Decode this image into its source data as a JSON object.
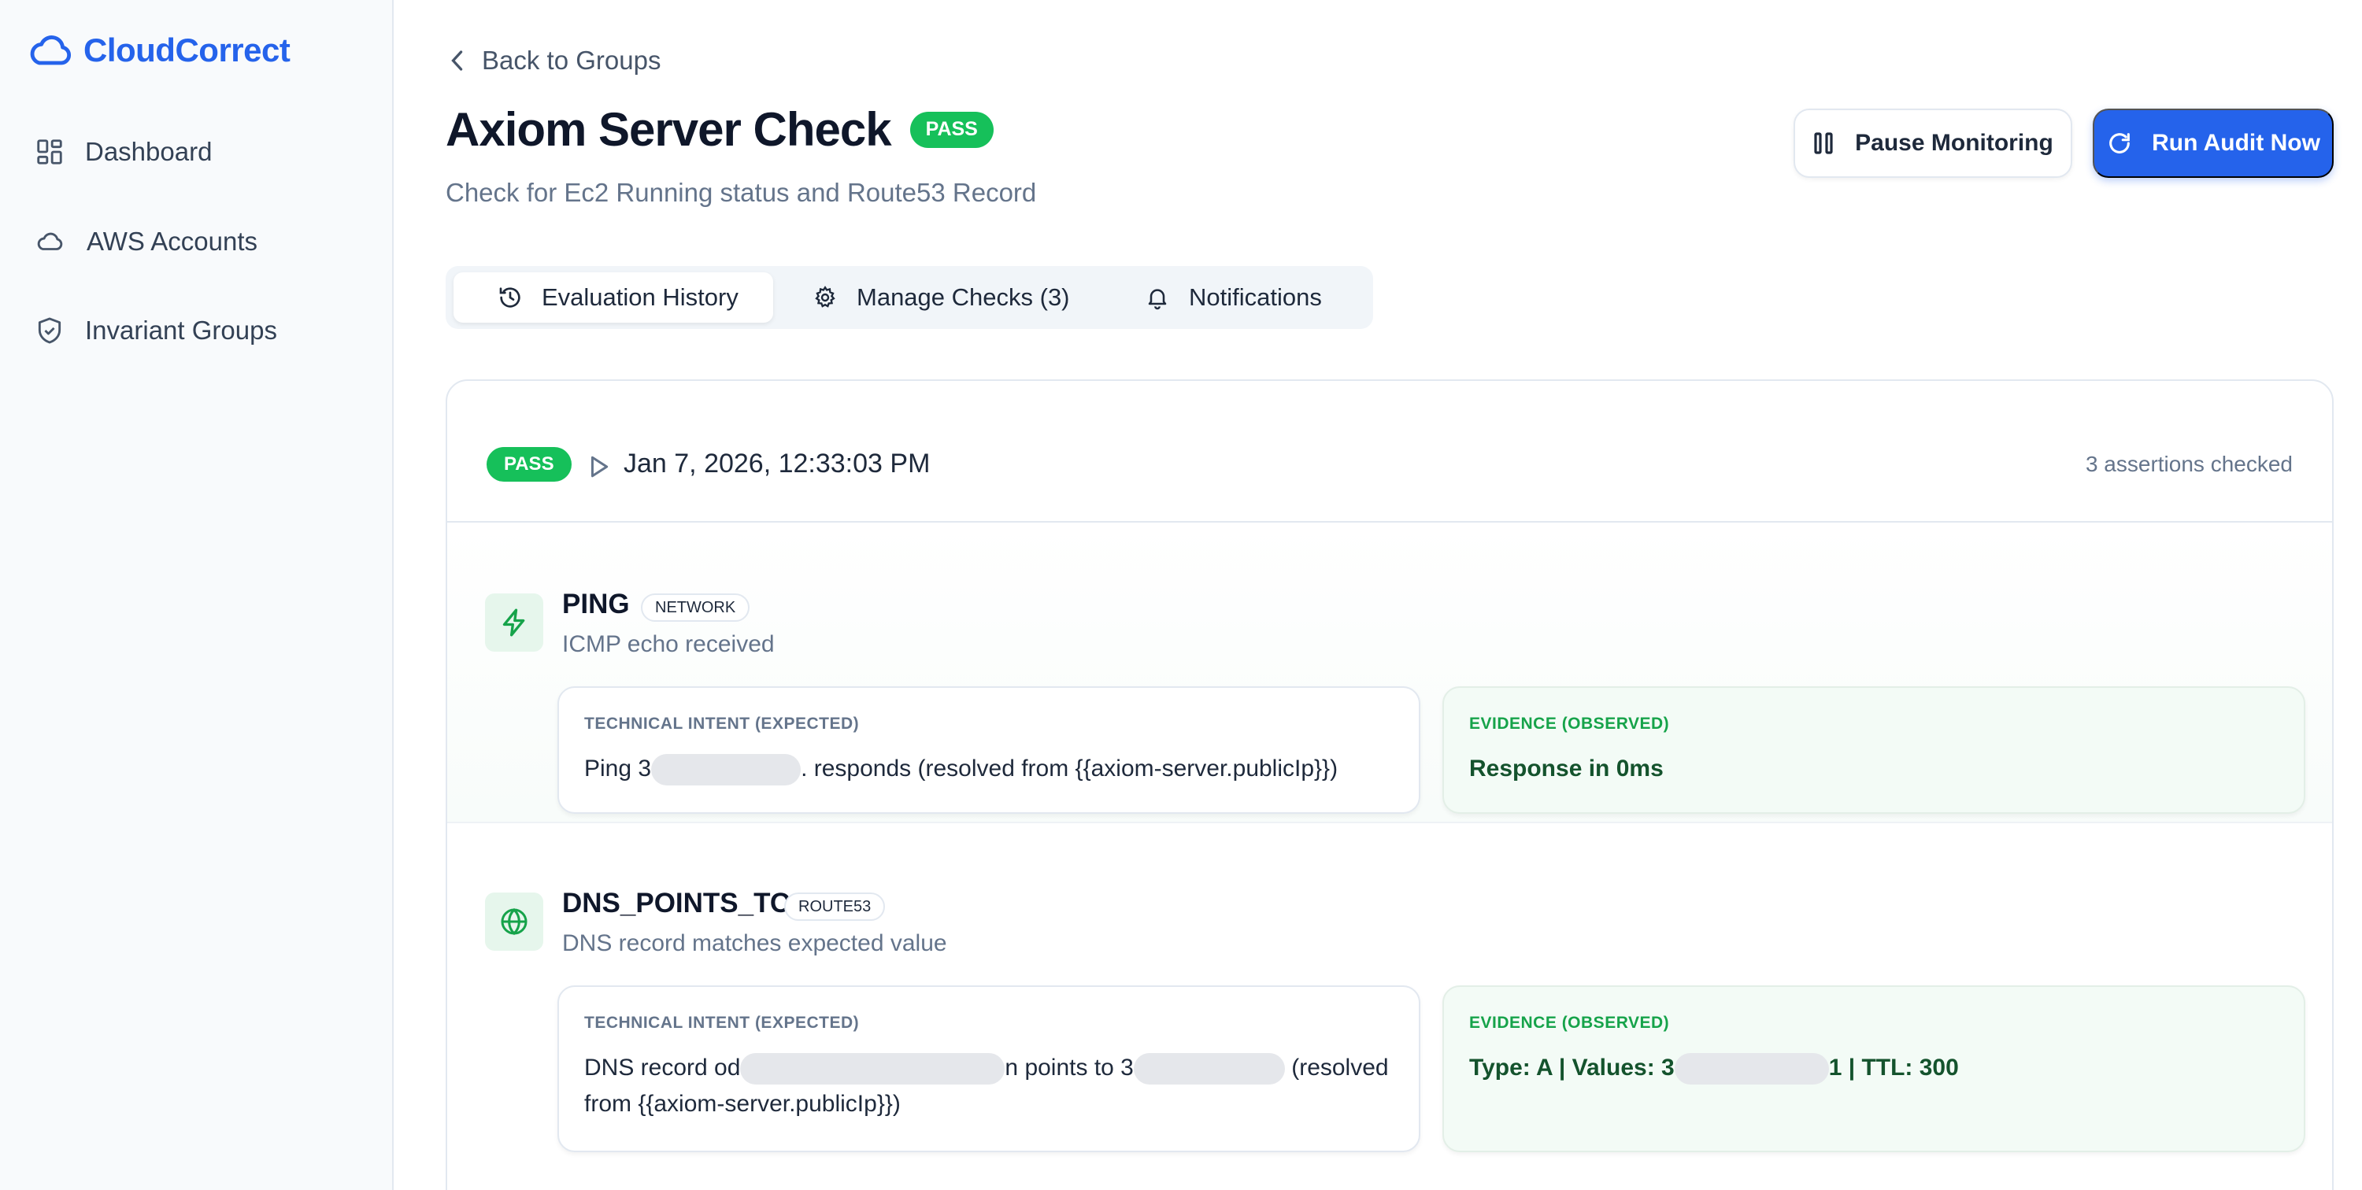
{
  "brand": {
    "name": "CloudCorrect"
  },
  "sidebar": {
    "items": [
      {
        "label": "Dashboard",
        "icon": "dashboard-icon"
      },
      {
        "label": "AWS Accounts",
        "icon": "cloud-icon"
      },
      {
        "label": "Invariant Groups",
        "icon": "shield-icon"
      }
    ]
  },
  "header": {
    "back_label": "Back to Groups",
    "title": "Axiom Server Check",
    "status": "PASS",
    "subtitle": "Check for Ec2 Running status and Route53 Record",
    "pause_label": "Pause Monitoring",
    "run_label": "Run Audit Now"
  },
  "tabs": [
    {
      "label": "Evaluation History",
      "icon": "history-icon",
      "active": true
    },
    {
      "label": "Manage Checks (3)",
      "icon": "gear-icon",
      "active": false
    },
    {
      "label": "Notifications",
      "icon": "bell-icon",
      "active": false
    }
  ],
  "evaluation": {
    "status": "PASS",
    "timestamp": "Jan 7, 2026, 12:33:03 PM",
    "assertions": "3 assertions checked",
    "checks": [
      {
        "name": "PING",
        "tag": "NETWORK",
        "description": "ICMP echo received",
        "intent_label": "TECHNICAL INTENT (EXPECTED)",
        "intent_pre": "Ping 3",
        "intent_post": ". responds (resolved from {{axiom-server.publicIp}})",
        "evidence_label": "EVIDENCE (OBSERVED)",
        "evidence": "Response in 0ms"
      },
      {
        "name": "DNS_POINTS_TO",
        "tag": "ROUTE53",
        "description": "DNS record matches expected value",
        "intent_label": "TECHNICAL INTENT (EXPECTED)",
        "intent_pre": "DNS record od",
        "intent_mid": "n points to 3",
        "intent_post": " (resolved",
        "intent_line2": "from {{axiom-server.publicIp}})",
        "evidence_label": "EVIDENCE (OBSERVED)",
        "evidence_pre": "Type: A | Values: 3",
        "evidence_post": "1 | TTL: 300"
      }
    ]
  },
  "colors": {
    "accent": "#2563eb",
    "pass": "#16c05a",
    "evidence_text": "#14532d"
  }
}
